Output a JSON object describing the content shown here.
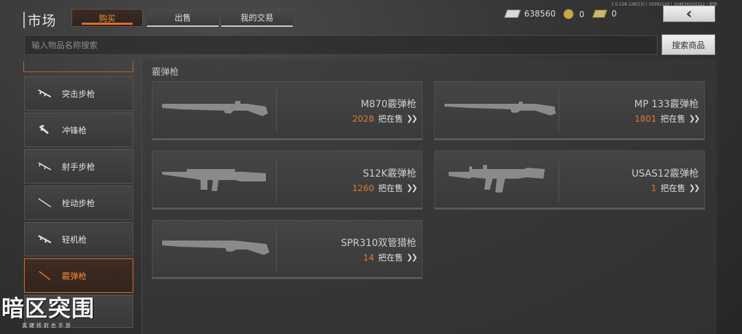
{
  "version": "1.0.128.128(13) | 10291120 | 104936303322 | 校验",
  "header": {
    "title": "市场",
    "tabs": [
      {
        "label": "购买",
        "active": true
      },
      {
        "label": "出售",
        "active": false
      },
      {
        "label": "我的交易",
        "active": false
      }
    ],
    "currencies": [
      {
        "icon": "cash-icon",
        "value": "638560"
      },
      {
        "icon": "coin-icon",
        "value": "0"
      },
      {
        "icon": "ticket-icon",
        "value": "0"
      }
    ],
    "back_glyph": "‹"
  },
  "search": {
    "placeholder": "输入物品名称搜索",
    "button": "搜索商品"
  },
  "sidebar": {
    "items": [
      {
        "label": "突击步枪",
        "icon": "assault-rifle-icon",
        "active": false
      },
      {
        "label": "冲锋枪",
        "icon": "smg-icon",
        "active": false
      },
      {
        "label": "射手步枪",
        "icon": "marksman-rifle-icon",
        "active": false
      },
      {
        "label": "栓动步枪",
        "icon": "bolt-rifle-icon",
        "active": false
      },
      {
        "label": "轻机枪",
        "icon": "lmg-icon",
        "active": false
      },
      {
        "label": "霰弹枪",
        "icon": "shotgun-icon",
        "active": true
      }
    ]
  },
  "main": {
    "section_title": "霰弹枪",
    "items": [
      {
        "name": "M870霰弹枪",
        "count": "2028",
        "sale_label": "把在售"
      },
      {
        "name": "MP 133霰弹枪",
        "count": "1801",
        "sale_label": "把在售"
      },
      {
        "name": "S12K霰弹枪",
        "count": "1260",
        "sale_label": "把在售"
      },
      {
        "name": "USAS12霰弹枪",
        "count": "1",
        "sale_label": "把在售"
      },
      {
        "name": "SPR310双管猎枪",
        "count": "14",
        "sale_label": "把在售"
      }
    ]
  },
  "logo": {
    "title": "暗区突围",
    "subtitle": "真硬核射击手游"
  },
  "colors": {
    "accent": "#e8772e",
    "background": "#353535"
  }
}
